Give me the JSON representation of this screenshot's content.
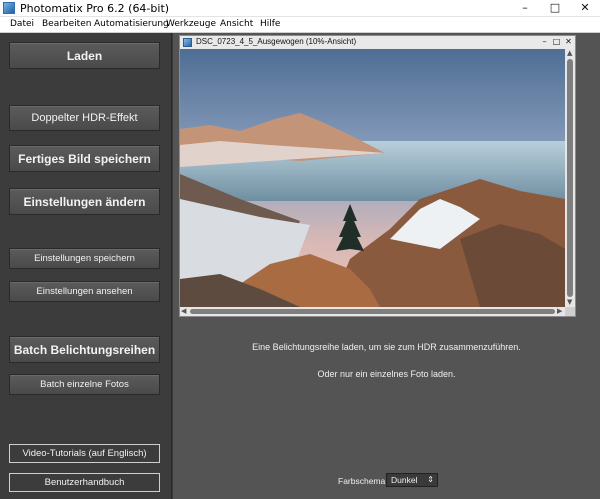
{
  "window": {
    "title": "Photomatix Pro 6.2 (64-bit)",
    "controls": [
      "–",
      "□",
      "✕"
    ]
  },
  "menu": [
    "Datei",
    "Bearbeiten",
    "Automatisierung",
    "Werkzeuge",
    "Ansicht",
    "Hilfe"
  ],
  "left_panel": {
    "load": "Laden",
    "double_hdr": "Doppelter HDR-Effekt",
    "save_finished": "Fertiges Bild speichern",
    "change_settings": "Einstellungen ändern",
    "save_settings": "Einstellungen speichern",
    "view_settings": "Einstellungen ansehen",
    "batch_brackets": "Batch Belichtungsreihen",
    "batch_single": "Batch einzelne Fotos",
    "video_tutorials": "Video-Tutorials (auf Englisch)",
    "manual": "Benutzerhandbuch"
  },
  "image_window": {
    "title": "DSC_0723_4_5_Ausgewogen (10%-Ansicht)",
    "controls": [
      "–",
      "□",
      "✕"
    ]
  },
  "main": {
    "message_line1": "Eine Belichtungsreihe laden, um sie zum HDR zusammenzuführen.",
    "message_line2": "Oder nur ein einzelnes Foto laden.",
    "color_scheme_label": "Farbschema:",
    "color_scheme_value": "Dunkel"
  }
}
